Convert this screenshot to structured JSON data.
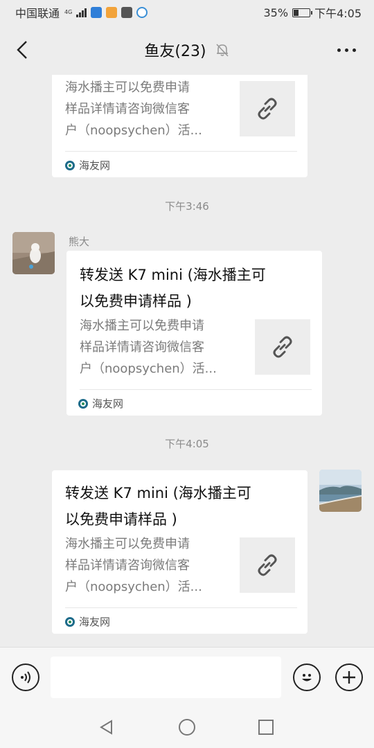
{
  "status_bar": {
    "carrier": "中国联通",
    "network": "4G",
    "battery_percent": "35%",
    "time": "下午4:05",
    "battery_level": 0.35
  },
  "header": {
    "title": "鱼友(23)",
    "back_icon": "chevron-left-icon",
    "mute_icon": "bell-off-icon",
    "more_icon": "more-dots-icon"
  },
  "messages": [
    {
      "kind": "link-card",
      "side": "left-partial",
      "description": "海水播主可以免费申请样品详情请咨询微信客户（noopsychen）活...",
      "description_lines": [
        "海水播主可以免费申请",
        "样品详情请咨询微信客",
        "户（noopsychen）活..."
      ],
      "source": "海友网"
    },
    {
      "kind": "timestamp",
      "text": "下午3:46"
    },
    {
      "kind": "link-card",
      "side": "left",
      "sender": "熊大",
      "title_lines": [
        "转发送 K7 mini (海水播主可",
        "以免费申请样品 )"
      ],
      "description_lines": [
        "海水播主可以免费申请",
        "样品详情请咨询微信客",
        "户（noopsychen）活..."
      ],
      "source": "海友网"
    },
    {
      "kind": "timestamp",
      "text": "下午4:05"
    },
    {
      "kind": "link-card",
      "side": "right",
      "title_lines": [
        "转发送 K7 mini (海水播主可",
        "以免费申请样品 )"
      ],
      "description_lines": [
        "海水播主可以免费申请",
        "样品详情请咨询微信客",
        "户（noopsychen）活..."
      ],
      "source": "海友网"
    }
  ],
  "input_bar": {
    "voice_icon": "voice-icon",
    "emoji_icon": "emoji-icon",
    "plus_icon": "plus-icon",
    "text_value": ""
  },
  "nav_bar": {
    "back_icon": "triangle-back-icon",
    "home_icon": "circle-home-icon",
    "recent_icon": "square-recent-icon"
  },
  "colors": {
    "chat_bg": "#ededed",
    "card_bg": "#ffffff",
    "muted_text": "#7b7b7b"
  }
}
